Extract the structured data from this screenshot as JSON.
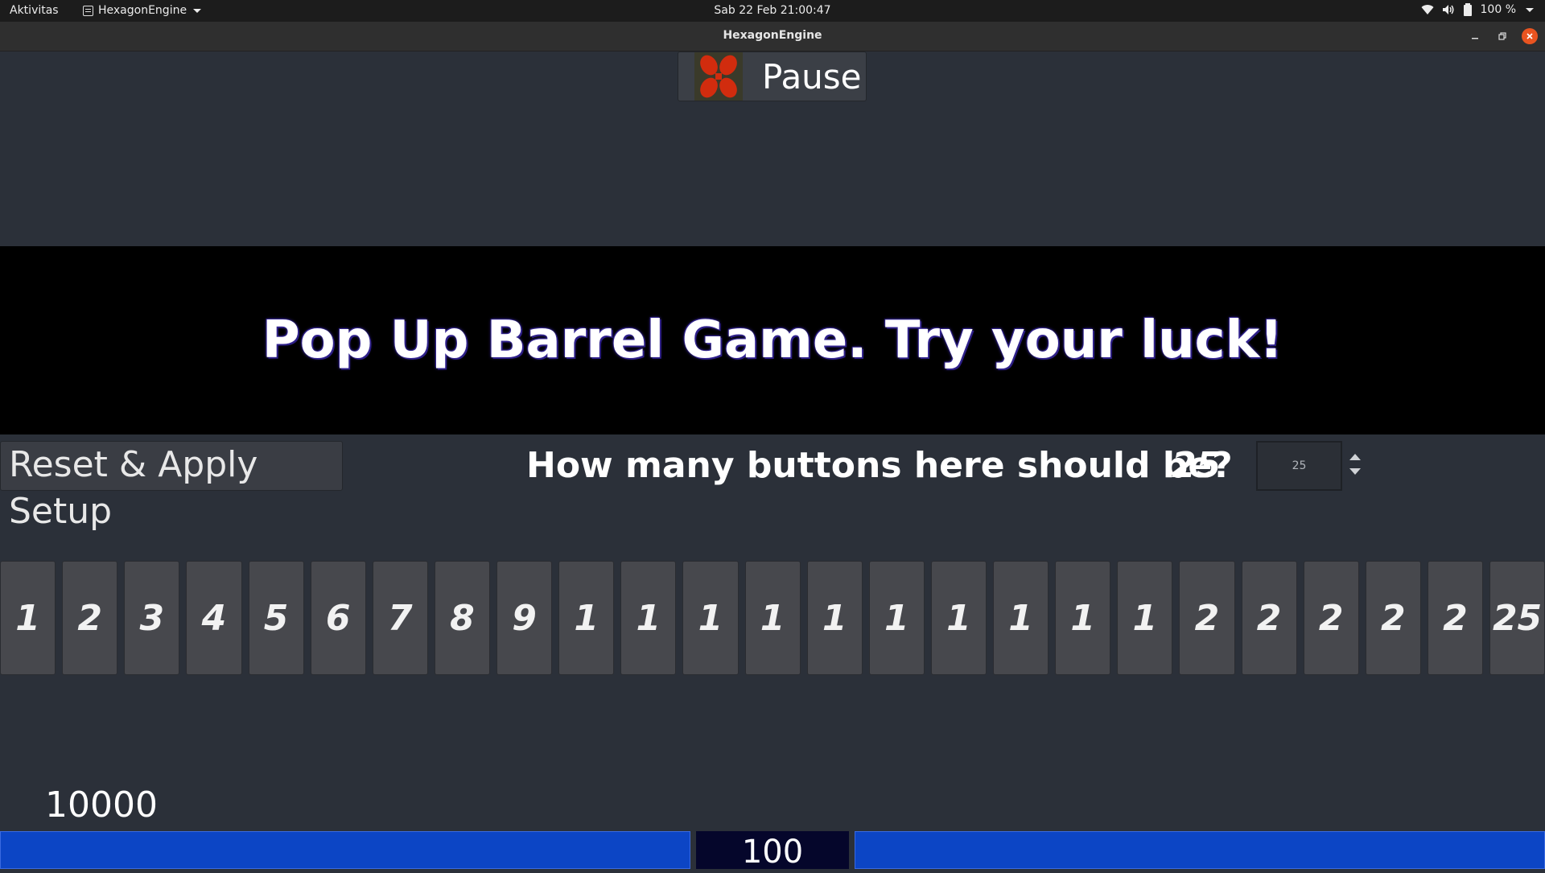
{
  "topbar": {
    "activities": "Aktivitas",
    "app_name": "HexagonEngine",
    "clock": "Sab 22 Feb  21:00:47",
    "battery": "100 %"
  },
  "window": {
    "title": "HexagonEngine"
  },
  "pause_button": {
    "label": "Pause",
    "icon": "red-barrel-icon"
  },
  "banner": {
    "text": "Pop Up Barrel Game. Try your luck!"
  },
  "setup": {
    "reset_label": "Reset & Apply Setup",
    "question": "How many buttons here should be?",
    "count_value": "25",
    "spin_value": "25"
  },
  "number_buttons": [
    "1",
    "2",
    "3",
    "4",
    "5",
    "6",
    "7",
    "8",
    "9",
    "1",
    "1",
    "1",
    "1",
    "1",
    "1",
    "1",
    "1",
    "1",
    "1",
    "2",
    "2",
    "2",
    "2",
    "2",
    "25"
  ],
  "score": "10000",
  "bottom": {
    "center_value": "100",
    "bar_color": "#0c45c5"
  }
}
